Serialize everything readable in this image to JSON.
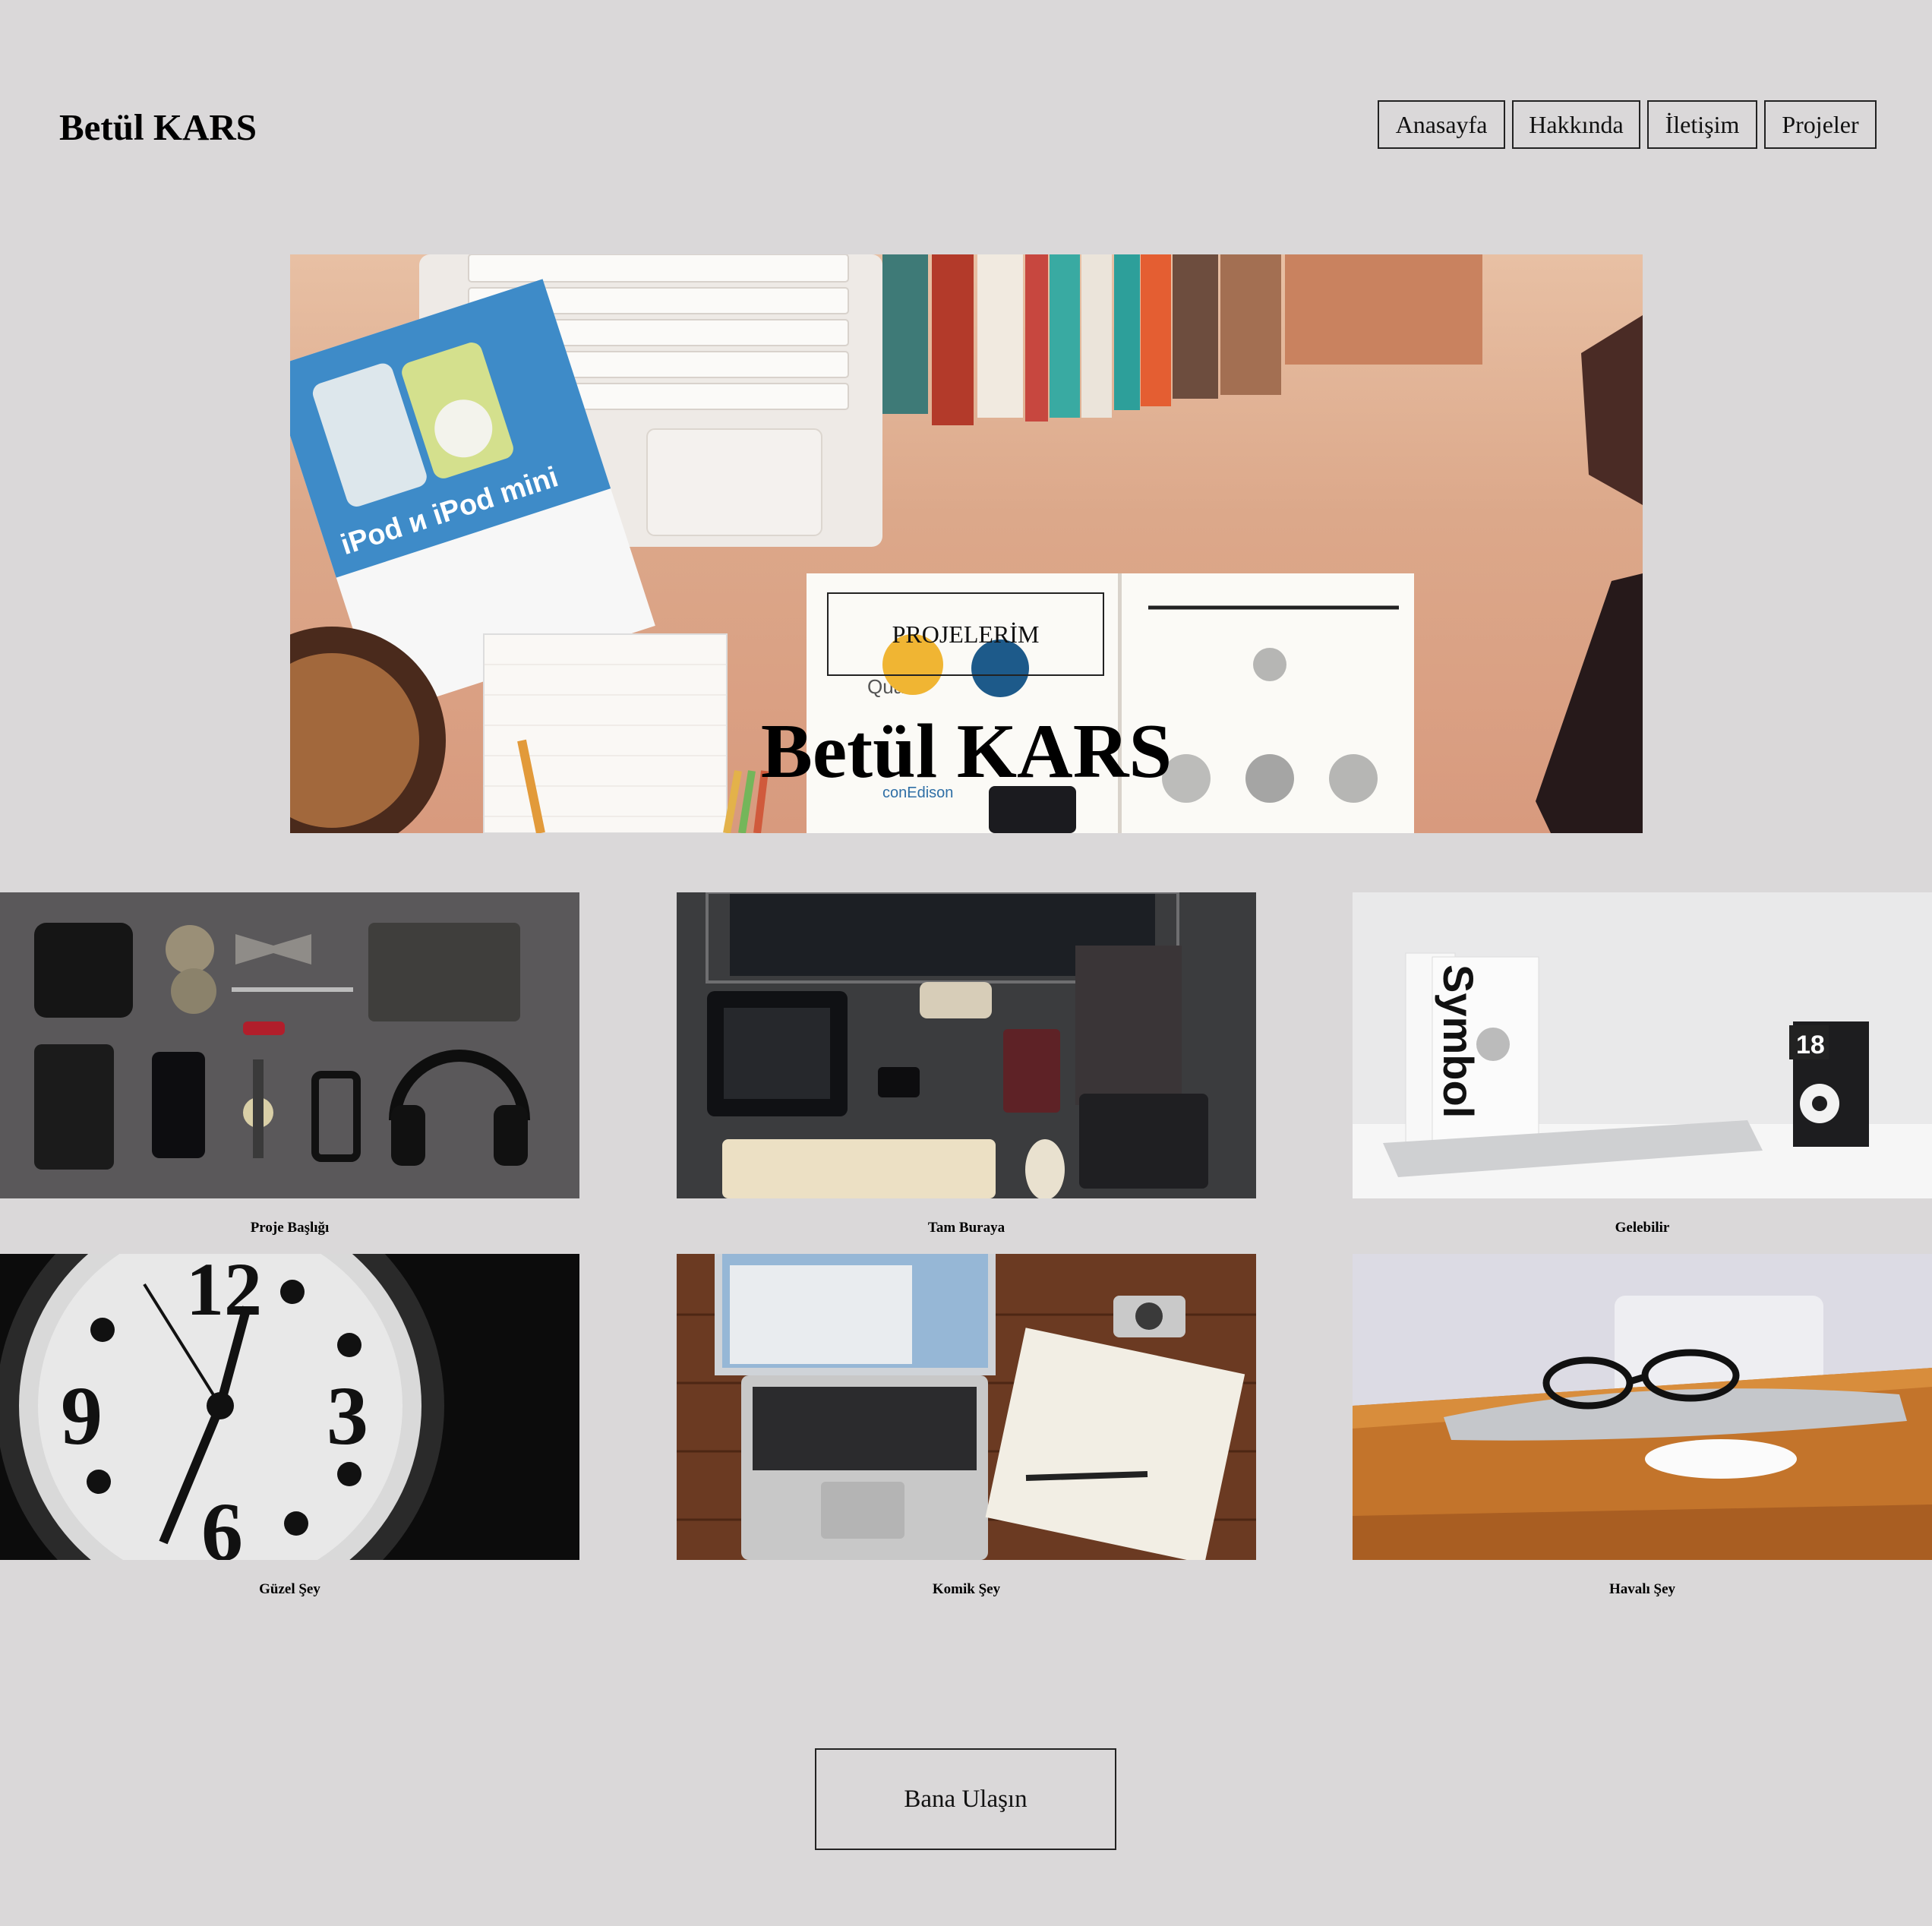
{
  "header": {
    "site_title": "Betül KARS",
    "nav": [
      "Anasayfa",
      "Hakkında",
      "İletişim",
      "Projeler"
    ]
  },
  "hero": {
    "title": "Betül KARS",
    "button_label": "PROJELERİM",
    "image_text": {
      "ipod": "iPod и iPod mini",
      "quark": "Quark",
      "conedison": "conEdison"
    }
  },
  "projects": [
    {
      "caption": "Proje Başlığı"
    },
    {
      "caption": "Tam Buraya"
    },
    {
      "caption": "Gelebilir",
      "image_text": {
        "book": "Symbol",
        "calendar": "18"
      }
    },
    {
      "caption": "Güzel Şey",
      "image_text": {
        "n12": "12",
        "n3": "3",
        "n6": "6",
        "n9": "9"
      }
    },
    {
      "caption": "Komik Şey"
    },
    {
      "caption": "Havalı Şey"
    }
  ],
  "footer": {
    "contact_label": "Bana Ulaşın"
  }
}
